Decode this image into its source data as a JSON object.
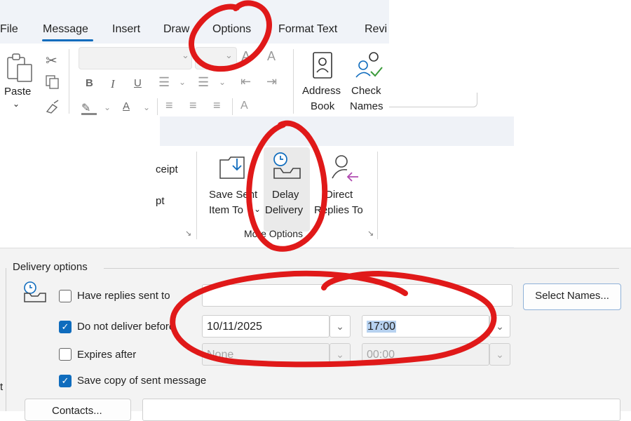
{
  "ribbon_tabs": {
    "file": "File",
    "message": "Message",
    "insert": "Insert",
    "draw": "Draw",
    "options": "Options",
    "format_text": "Format Text",
    "review": "Revi"
  },
  "clipboard": {
    "paste": "Paste"
  },
  "font": {
    "bold": "B",
    "italic": "I",
    "underline": "U",
    "grow": "A",
    "shrink": "A"
  },
  "names": {
    "address_book_line1": "Address",
    "address_book_line2": "Book",
    "check_names_line1": "Check",
    "check_names_line2": "Names"
  },
  "more_options": {
    "receipt_partial": "ceipt",
    "request_partial": "pt",
    "save_sent_line1": "Save Sent",
    "save_sent_line2": "Item To",
    "delay_line1": "Delay",
    "delay_line2": "Delivery",
    "direct_line1": "Direct",
    "direct_line2": "Replies To",
    "group_label": "More Options"
  },
  "delivery": {
    "section_title": "Delivery options",
    "have_replies_label": "Have replies sent to",
    "have_replies_value": "",
    "select_names_button": "Select Names...",
    "do_not_deliver_label": "Do not deliver before",
    "do_not_deliver_checked": true,
    "deliver_date": "10/11/2025",
    "deliver_time": "17:00",
    "expires_label": "Expires after",
    "expires_checked": false,
    "expires_date": "None",
    "expires_time": "00:00",
    "save_copy_label": "Save copy of sent message",
    "save_copy_checked": true,
    "contacts_partial": "Contacts...",
    "left_edge_partial": "t"
  },
  "colors": {
    "accent": "#0f6cbd",
    "annotation": "#e01919"
  }
}
